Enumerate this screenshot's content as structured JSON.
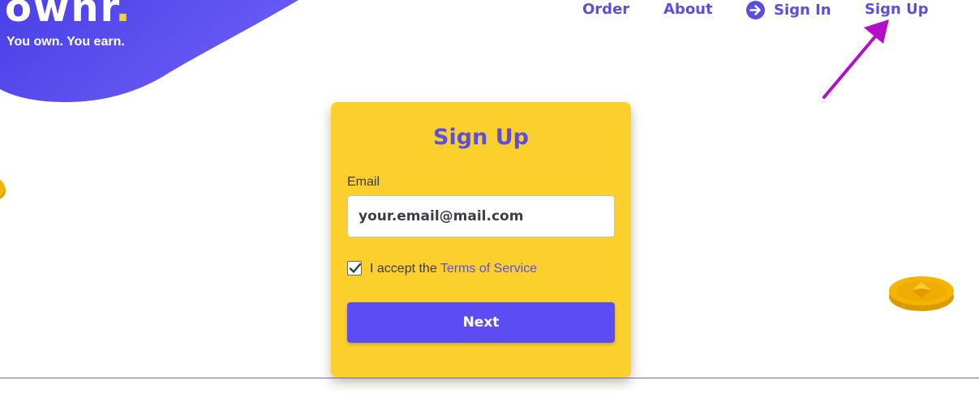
{
  "brand": {
    "logo_text": "ownr",
    "logo_dot": ".",
    "tagline": "You own. You earn."
  },
  "nav": {
    "order": "Order",
    "about": "About",
    "sign_in": "Sign In",
    "sign_up": "Sign Up",
    "sign_in_icon": "arrow-right-circle-icon"
  },
  "signup_form": {
    "title": "Sign Up",
    "email_label": "Email",
    "email_placeholder": "your.email@mail.com",
    "email_value": "",
    "terms_checked": true,
    "accept_prefix": "I accept the",
    "terms_link": "Terms of Service",
    "next_button": "Next"
  },
  "colors": {
    "brand_purple": "#5a4fdc",
    "button_purple": "#5b4cf4",
    "card_yellow": "#fcd02c",
    "annotation_magenta": "#b40fc8"
  }
}
